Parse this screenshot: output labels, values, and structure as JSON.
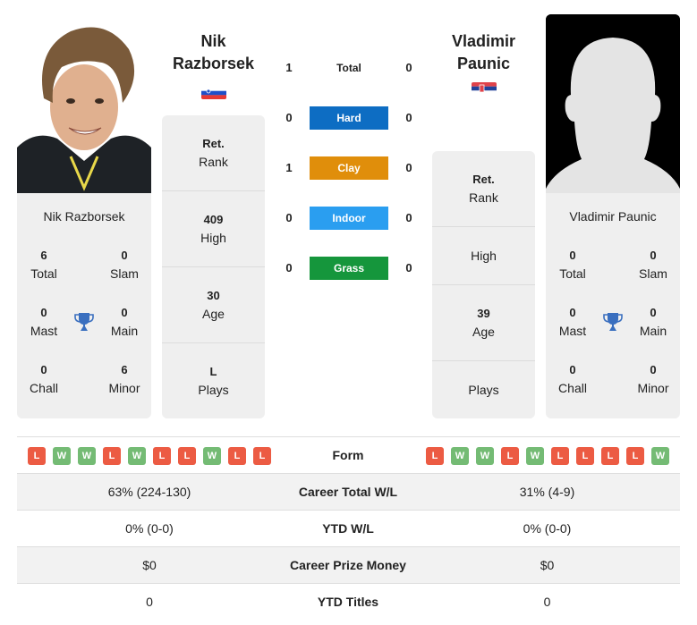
{
  "colors": {
    "hard": "#0d6dc3",
    "clay": "#e08e0b",
    "indoor": "#2a9ef0",
    "grass": "#15963c",
    "win": "#74bb74",
    "loss": "#ec5b43",
    "trophy": "#3a6fbf"
  },
  "player1": {
    "name_line1": "Nik",
    "name_line2": "Razborsek",
    "full_name": "Nik Razborsek",
    "flag": "slovenia-flag",
    "rank_cells": [
      {
        "value": "Ret.",
        "label": "Rank"
      },
      {
        "value": "409",
        "label": "High"
      },
      {
        "value": "30",
        "label": "Age"
      },
      {
        "value": "L",
        "label": "Plays"
      }
    ],
    "titles": {
      "total": {
        "value": "6",
        "label": "Total"
      },
      "slam": {
        "value": "0",
        "label": "Slam"
      },
      "mast": {
        "value": "0",
        "label": "Mast"
      },
      "main": {
        "value": "0",
        "label": "Main"
      },
      "chall": {
        "value": "0",
        "label": "Chall"
      },
      "minor": {
        "value": "6",
        "label": "Minor"
      }
    },
    "form": [
      "L",
      "W",
      "W",
      "L",
      "W",
      "L",
      "L",
      "W",
      "L",
      "L"
    ],
    "career_wl": "63% (224-130)",
    "ytd_wl": "0% (0-0)",
    "prize_money": "$0",
    "ytd_titles": "0"
  },
  "player2": {
    "name_line1": "Vladimir",
    "name_line2": "Paunic",
    "full_name": "Vladimir Paunic",
    "flag": "serbia-flag",
    "rank_cells": [
      {
        "value": "Ret.",
        "label": "Rank"
      },
      {
        "value": "",
        "label": "High"
      },
      {
        "value": "39",
        "label": "Age"
      },
      {
        "value": "",
        "label": "Plays"
      }
    ],
    "titles": {
      "total": {
        "value": "0",
        "label": "Total"
      },
      "slam": {
        "value": "0",
        "label": "Slam"
      },
      "mast": {
        "value": "0",
        "label": "Mast"
      },
      "main": {
        "value": "0",
        "label": "Main"
      },
      "chall": {
        "value": "0",
        "label": "Chall"
      },
      "minor": {
        "value": "0",
        "label": "Minor"
      }
    },
    "form": [
      "L",
      "W",
      "W",
      "L",
      "W",
      "L",
      "L",
      "L",
      "L",
      "W"
    ],
    "career_wl": "31% (4-9)",
    "ytd_wl": "0% (0-0)",
    "prize_money": "$0",
    "ytd_titles": "0"
  },
  "h2h": [
    {
      "label": "Total",
      "p1": "1",
      "p2": "0",
      "surface": "total"
    },
    {
      "label": "Hard",
      "p1": "0",
      "p2": "0",
      "surface": "hard"
    },
    {
      "label": "Clay",
      "p1": "1",
      "p2": "0",
      "surface": "clay"
    },
    {
      "label": "Indoor",
      "p1": "0",
      "p2": "0",
      "surface": "indoor"
    },
    {
      "label": "Grass",
      "p1": "0",
      "p2": "0",
      "surface": "grass"
    }
  ],
  "table_labels": {
    "form": "Form",
    "career_wl": "Career Total W/L",
    "ytd_wl": "YTD W/L",
    "prize_money": "Career Prize Money",
    "ytd_titles": "YTD Titles"
  }
}
